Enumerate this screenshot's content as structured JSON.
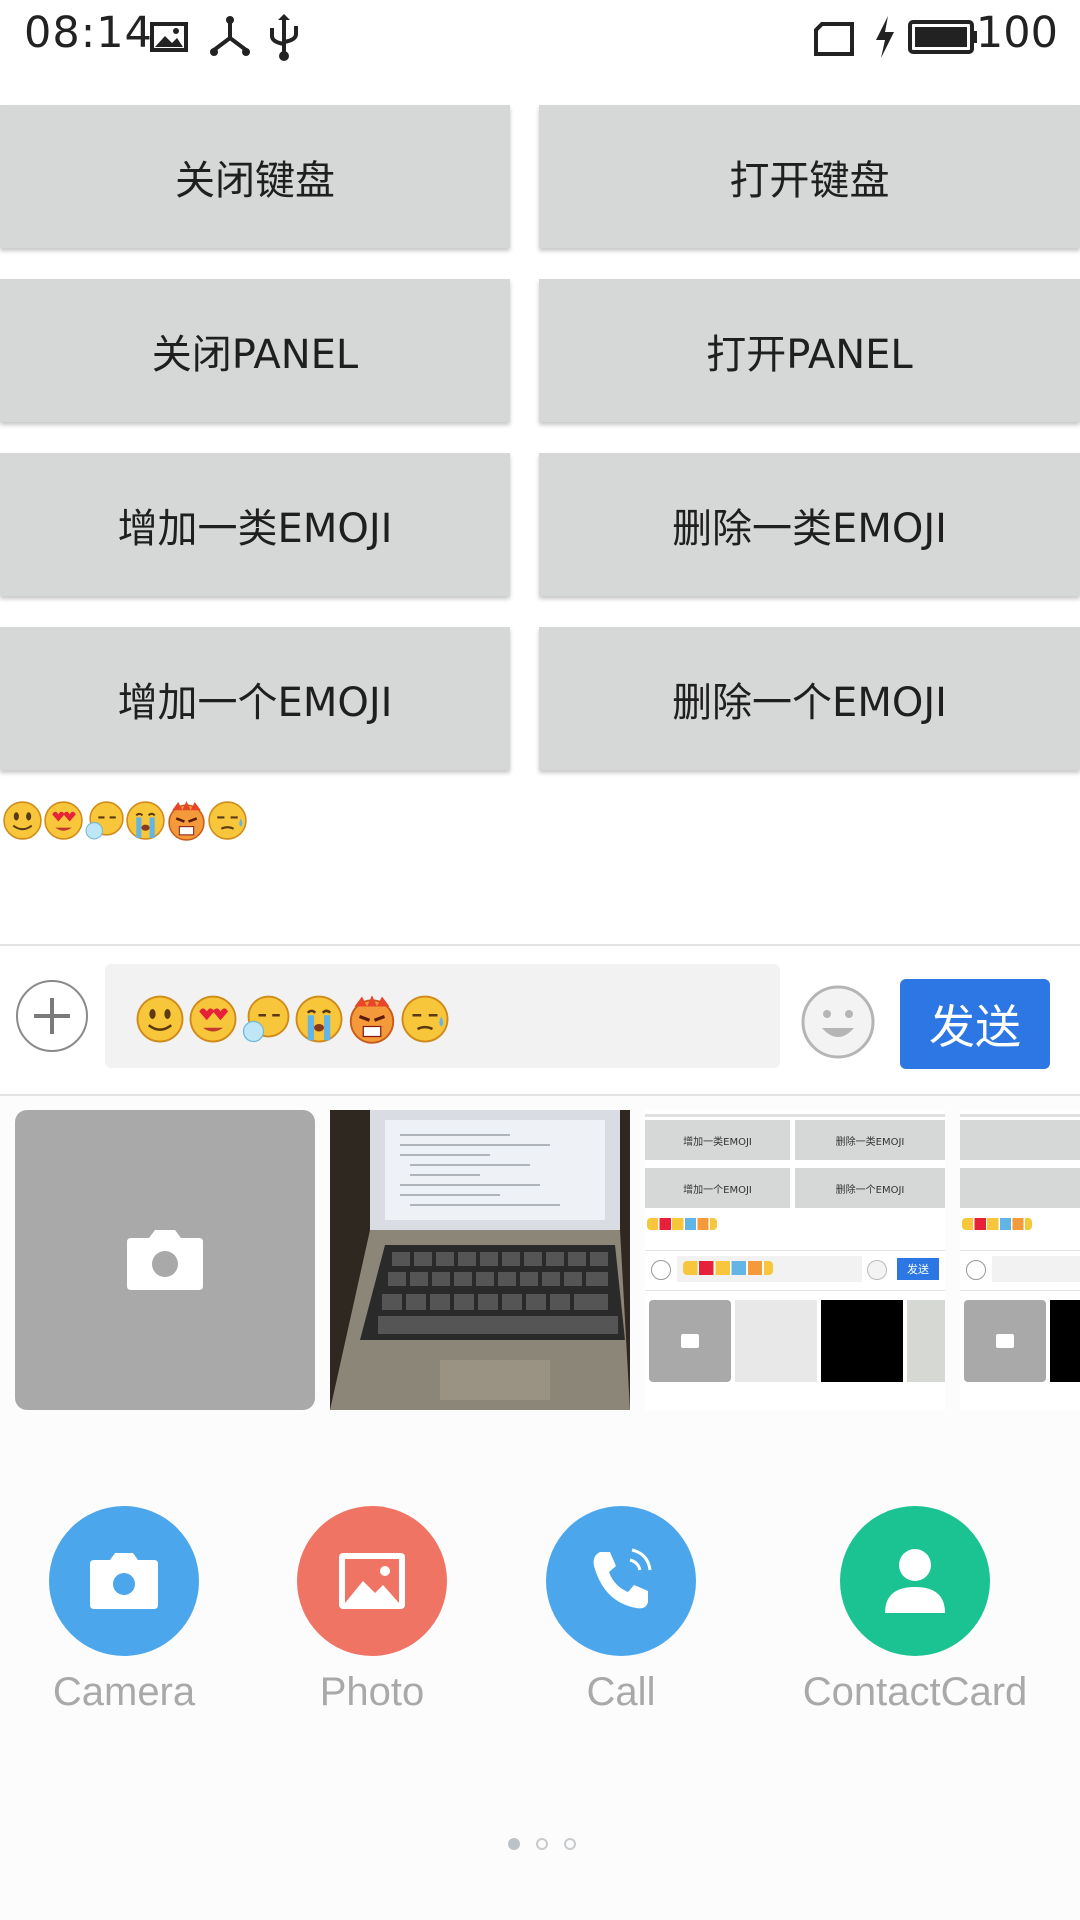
{
  "status_bar": {
    "time": "08:14",
    "battery_percent": "100",
    "icons": [
      "image-icon",
      "share-network-icon",
      "usb-icon",
      "sim-icon",
      "charging-bolt-icon",
      "battery-icon"
    ]
  },
  "buttons": {
    "close_keyboard": "关闭键盘",
    "open_keyboard": "打开键盘",
    "close_panel": "关闭PANEL",
    "open_panel": "打开PANEL",
    "add_emoji_category": "增加一类EMOJI",
    "delete_emoji_category": "删除一类EMOJI",
    "add_emoji": "增加一个EMOJI",
    "delete_emoji": "删除一个EMOJI"
  },
  "emojis": [
    "smile",
    "heart-eyes",
    "sleepy",
    "crying",
    "angry",
    "sweat"
  ],
  "input_bar": {
    "send_label": "发送"
  },
  "photo_strip": {
    "items": [
      "camera",
      "laptop-photo",
      "screenshot-1",
      "screenshot-2"
    ],
    "thumb_labels": {
      "add_category": "增加一类EMOJI",
      "delete_category": "删除一类EMOJI",
      "add_one": "增加一个EMOJI",
      "delete_one": "删除一个EMOJI",
      "send": "发送"
    }
  },
  "actions": [
    {
      "label": "Camera",
      "color": "#4ca6ec",
      "icon": "camera-icon"
    },
    {
      "label": "Photo",
      "color": "#f07463",
      "icon": "photo-icon"
    },
    {
      "label": "Call",
      "color": "#4ca6ec",
      "icon": "phone-icon"
    },
    {
      "label": "ContactCard",
      "color": "#1bc392",
      "icon": "person-icon"
    }
  ],
  "pager": {
    "pages": 3,
    "active": 1
  },
  "colors": {
    "accent": "#2c77e3",
    "button_bg": "#d6d7d7"
  }
}
